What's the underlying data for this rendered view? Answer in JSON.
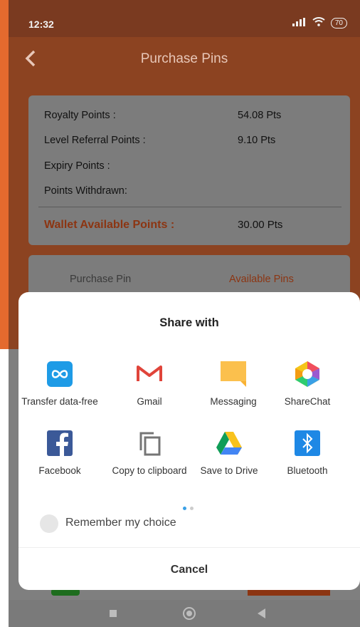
{
  "status_bar": {
    "time": "12:32",
    "signal_icon": "signal-icon",
    "wifi_icon": "wifi-icon",
    "battery": "70"
  },
  "header": {
    "title": "Purchase Pins",
    "back_icon": "back-arrow-icon"
  },
  "points": {
    "rows": [
      {
        "label": "Royalty Points :",
        "value": "54.08 Pts"
      },
      {
        "label": "Level Referral Points :",
        "value": "9.10 Pts"
      },
      {
        "label": "Expiry Points :",
        "value": ""
      },
      {
        "label": "Points Withdrawn:",
        "value": ""
      }
    ],
    "wallet": {
      "label": "Wallet Available Points :",
      "value": "30.00 Pts"
    }
  },
  "tabs": {
    "purchase": "Purchase Pin",
    "available": "Available Pins"
  },
  "share": {
    "title": "Share with",
    "apps": [
      {
        "label": "Transfer data-free",
        "icon": "transfer-icon"
      },
      {
        "label": "Gmail",
        "icon": "gmail-icon"
      },
      {
        "label": "Messaging",
        "icon": "messaging-icon"
      },
      {
        "label": "ShareChat",
        "icon": "sharechat-icon"
      },
      {
        "label": "Facebook",
        "icon": "facebook-icon"
      },
      {
        "label": "Copy to clipboard",
        "icon": "copy-icon"
      },
      {
        "label": "Save to Drive",
        "icon": "drive-icon"
      },
      {
        "label": "Bluetooth",
        "icon": "bluetooth-icon"
      }
    ],
    "remember": "Remember my choice",
    "cancel": "Cancel"
  },
  "colors": {
    "brand_orange": "#e46a2e",
    "accent_blue": "#3aa0e6"
  }
}
